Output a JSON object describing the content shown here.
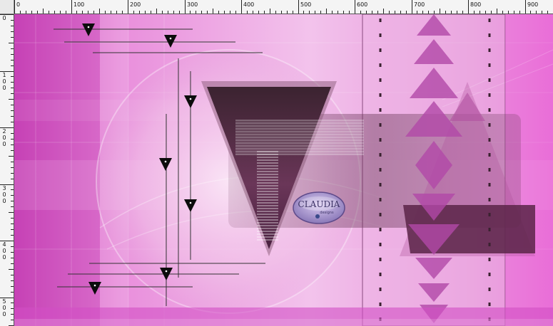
{
  "rulers": {
    "unit_step": 100,
    "top_labels": [
      "0",
      "100",
      "200",
      "300",
      "400",
      "500",
      "600",
      "700",
      "800",
      "900"
    ],
    "left_labels": [
      "0",
      "100",
      "200",
      "300",
      "400",
      "500"
    ]
  },
  "watermark": {
    "text": "CLAUDIA",
    "small_text": "designs"
  },
  "colors": {
    "magenta": "#d84fc8",
    "pink_light": "#f2b9ea",
    "plum_dark": "#3e2430",
    "purple_mid": "#a23e9a",
    "ruler_bg": "#f4f4f4"
  },
  "guides": {
    "marker_icon": "inverted-triangle-marker-icon",
    "marker_count": 9
  }
}
